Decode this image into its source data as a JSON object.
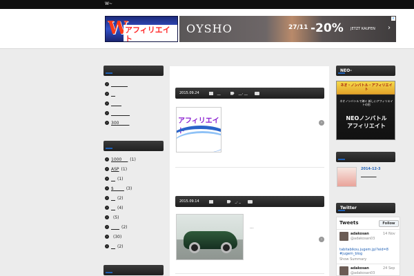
{
  "topbar": {
    "title": "W~"
  },
  "header": {
    "logo": {
      "letter": "W",
      "text": "アフィリエイト"
    },
    "ad": {
      "brand": "OYSHO",
      "date": "27/11",
      "discount": "-20%",
      "cta": "JETZT KAUFEN",
      "chevron": "›",
      "close": "x"
    }
  },
  "sidebar_left": {
    "widgets": [
      {
        "title": "__",
        "items": [
          {
            "label": "________",
            "count": ""
          },
          {
            "label": "__",
            "count": ""
          },
          {
            "label": "_____",
            "count": ""
          },
          {
            "label": "_________",
            "count": ""
          },
          {
            "label": "300_____",
            "count": ""
          }
        ]
      },
      {
        "title": "__",
        "items": [
          {
            "label": "1000___",
            "count": "(1)"
          },
          {
            "label": "ASP",
            "count": "(1)"
          },
          {
            "label": "__",
            "count": "(1)"
          },
          {
            "label": "$_____",
            "count": "(3)"
          },
          {
            "label": "__",
            "count": "(2)"
          },
          {
            "label": "__",
            "count": "(4)"
          },
          {
            "label": "",
            "count": "(5)"
          },
          {
            "label": "____",
            "count": "(2)"
          },
          {
            "label": "",
            "count": "(30)"
          },
          {
            "label": "__",
            "count": "(2)"
          }
        ]
      },
      {
        "title": "__"
      }
    ]
  },
  "posts": [
    {
      "date": "2015.09.24",
      "category": "__",
      "tags": "__, __",
      "thumb_text": "アフィリエイト",
      "excerpt": ""
    },
    {
      "date": "2015.09.14",
      "category": "",
      "tags": "_, _",
      "thumb_text": "",
      "excerpt": "..."
    }
  ],
  "sidebar_right": {
    "neo": {
      "title": "NEO-",
      "banner_top": "ネオ・ノンバトル・アフィリエイト",
      "banner_mid": "ネオノンバトルで稼ぐ 新しいアフィリエイトの形",
      "banner_line1": "NEOノンバトル",
      "banner_line2": "アフィリエイト"
    },
    "recent": {
      "title": "__",
      "date": "2014-12-3",
      "link": "_________"
    },
    "twitter": {
      "title": "Twitter",
      "header": "Tweets",
      "follow": "Follow",
      "tweets": [
        {
          "name": "adakosan",
          "handle": "@adakosan03",
          "date": "14 Nov",
          "text": "tabitabikou.jugem.jp/?eid=8 #jugem_blog",
          "summary": "Show Summary"
        },
        {
          "name": "adakosan",
          "handle": "@adakosan03",
          "date": "24 Sep",
          "text": "",
          "summary": ""
        }
      ]
    }
  }
}
